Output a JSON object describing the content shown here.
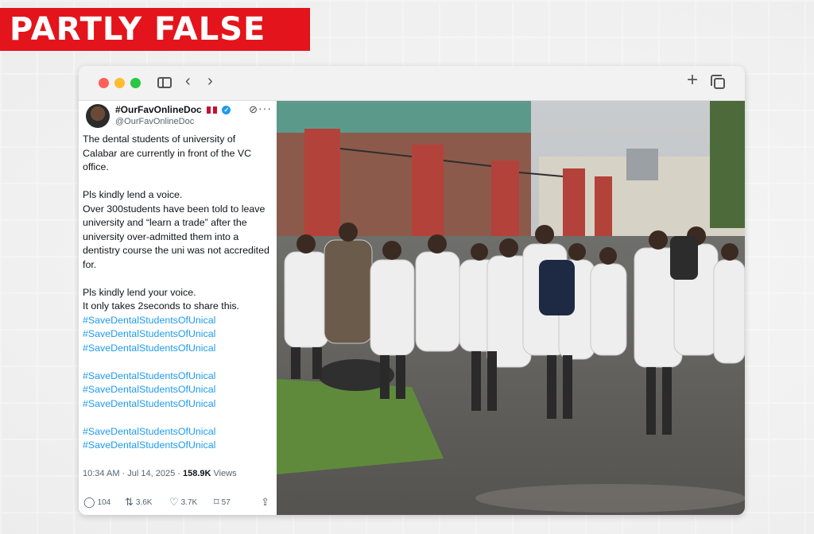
{
  "verdict": "PARTLY FALSE",
  "browser": {
    "nav_back": "‹",
    "nav_forward": "›",
    "new_tab": "+"
  },
  "tweet": {
    "display_name": "#OurFavOnlineDoc",
    "handle": "@OurFavOnlineDoc",
    "body": {
      "p1": "The dental students of university of Calabar are currently in front of the VC office.",
      "p2_line1": "Pls kindly lend a voice.",
      "p2_line2": "Over 300students have been told to leave university and “learn a trade” after the university over-admitted them into a dentistry course the uni was not accredited for.",
      "p3_line1": "Pls kindly lend your voice.",
      "p3_line2": "It only takes 2seconds to share this."
    },
    "hashtags_block1": [
      "#SaveDentalStudentsOfUnical",
      "#SaveDentalStudentsOfUnical",
      "#SaveDentalStudentsOfUnical"
    ],
    "hashtags_block2": [
      "#SaveDentalStudentsOfUnical",
      "#SaveDentalStudentsOfUnical",
      "#SaveDentalStudentsOfUnical"
    ],
    "hashtags_block3": [
      "#SaveDentalStudentsOfUnical",
      "#SaveDentalStudentsOfUnical"
    ],
    "timestamp": "10:34 AM · Jul 14, 2025 · ",
    "views_count": "158.9K",
    "views_label": "Views",
    "actions": {
      "replies": "104",
      "reposts": "3.6K",
      "likes": "3.7K",
      "bookmarks": "57"
    }
  },
  "colors": {
    "verdict_bg": "#e3141b",
    "link": "#1d9bf0",
    "verified": "#1d9bf0"
  }
}
